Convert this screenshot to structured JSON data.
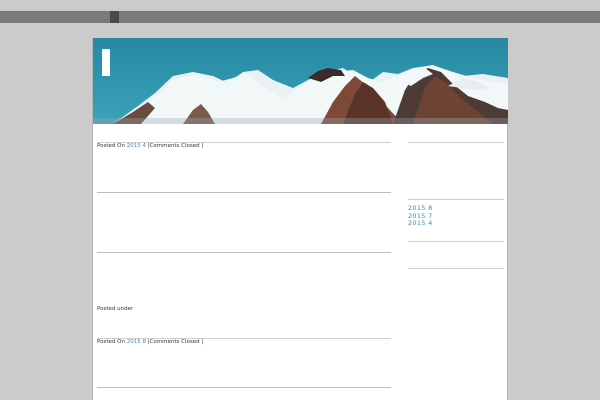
{
  "post1": {
    "meta_prefix": "Posted On",
    "date_link": "2015  4",
    "comments": "|Comments Closed |"
  },
  "post2": {
    "posted_under": "Posted under",
    "meta_prefix": "Posted On",
    "date_link": "2015  8",
    "comments": "|Comments Closed |"
  },
  "sidebar": {
    "archives": [
      "2015  8",
      "2015  7",
      "2015  4"
    ]
  },
  "colors": {
    "link": "#3d8fb5",
    "sky": "#2a8fa8",
    "backdrop": "#cbcbcb"
  }
}
